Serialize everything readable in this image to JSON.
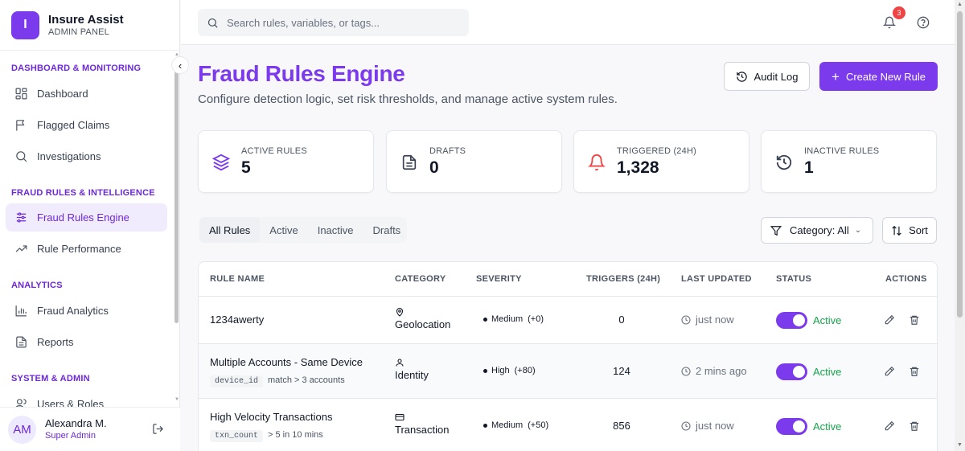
{
  "brand": {
    "logo_letter": "I",
    "name": "Insure Assist",
    "subtitle": "ADMIN PANEL"
  },
  "sidebar": {
    "sections": [
      {
        "title": "DASHBOARD & MONITORING"
      },
      {
        "title": "FRAUD RULES & INTELLIGENCE"
      },
      {
        "title": "ANALYTICS"
      },
      {
        "title": "SYSTEM & ADMIN"
      }
    ],
    "items": [
      {
        "label": "Dashboard",
        "icon": "grid-icon"
      },
      {
        "label": "Flagged Claims",
        "icon": "flag-icon"
      },
      {
        "label": "Investigations",
        "icon": "search-icon"
      },
      {
        "label": "Fraud Rules Engine",
        "icon": "sliders-icon",
        "active": true
      },
      {
        "label": "Rule Performance",
        "icon": "trending-up-icon"
      },
      {
        "label": "Fraud Analytics",
        "icon": "bar-chart-icon"
      },
      {
        "label": "Reports",
        "icon": "file-text-icon"
      },
      {
        "label": "Users & Roles",
        "icon": "users-icon"
      }
    ],
    "collapse_glyph": "‹",
    "user": {
      "initials": "AM",
      "name": "Alexandra M.",
      "role": "Super Admin"
    }
  },
  "topbar": {
    "search_placeholder": "Search rules, variables, or tags...",
    "notification_count": "3"
  },
  "header": {
    "title": "Fraud Rules Engine",
    "subtitle": "Configure detection logic, set risk thresholds, and manage active system rules.",
    "audit_label": "Audit Log",
    "create_label": "Create New Rule",
    "create_glyph": "+"
  },
  "stats": [
    {
      "label": "ACTIVE RULES",
      "value": "5",
      "icon": "layers-icon",
      "color": "#7c3aed"
    },
    {
      "label": "DRAFTS",
      "value": "0",
      "icon": "document-icon",
      "color": "#374151"
    },
    {
      "label": "TRIGGERED (24H)",
      "value": "1,328",
      "icon": "bell-icon",
      "color": "#ef4444"
    },
    {
      "label": "INACTIVE RULES",
      "value": "1",
      "icon": "history-icon",
      "color": "#374151"
    }
  ],
  "tabs": [
    {
      "label": "All Rules",
      "active": true
    },
    {
      "label": "Active"
    },
    {
      "label": "Inactive"
    },
    {
      "label": "Drafts"
    }
  ],
  "filter": {
    "label": "Category: All",
    "chevron": "⌄"
  },
  "sort": {
    "label": "Sort"
  },
  "table": {
    "columns": [
      "RULE NAME",
      "CATEGORY",
      "SEVERITY",
      "TRIGGERS (24H)",
      "LAST UPDATED",
      "STATUS",
      "ACTIONS"
    ],
    "rows": [
      {
        "name": "1234awerty",
        "variable": "",
        "condition": "",
        "category": "Geolocation",
        "category_icon": "map-pin-icon",
        "severity": "Medium",
        "delta": "(+0)",
        "triggers": "0",
        "updated": "just now",
        "status": "Active",
        "enabled": true
      },
      {
        "name": "Multiple Accounts - Same Device",
        "variable": "device_id",
        "condition": "match > 3 accounts",
        "category": "Identity",
        "category_icon": "user-icon",
        "severity": "High",
        "delta": "(+80)",
        "triggers": "124",
        "updated": "2 mins ago",
        "status": "Active",
        "enabled": true
      },
      {
        "name": "High Velocity Transactions",
        "variable": "txn_count",
        "condition": "> 5 in 10 mins",
        "category": "Transaction",
        "category_icon": "credit-card-icon",
        "severity": "Medium",
        "delta": "(+50)",
        "triggers": "856",
        "updated": "just now",
        "status": "Active",
        "enabled": true
      }
    ]
  },
  "colors": {
    "accent": "#7c3aed",
    "active_status": "#16a34a",
    "alert": "#ef4444"
  }
}
